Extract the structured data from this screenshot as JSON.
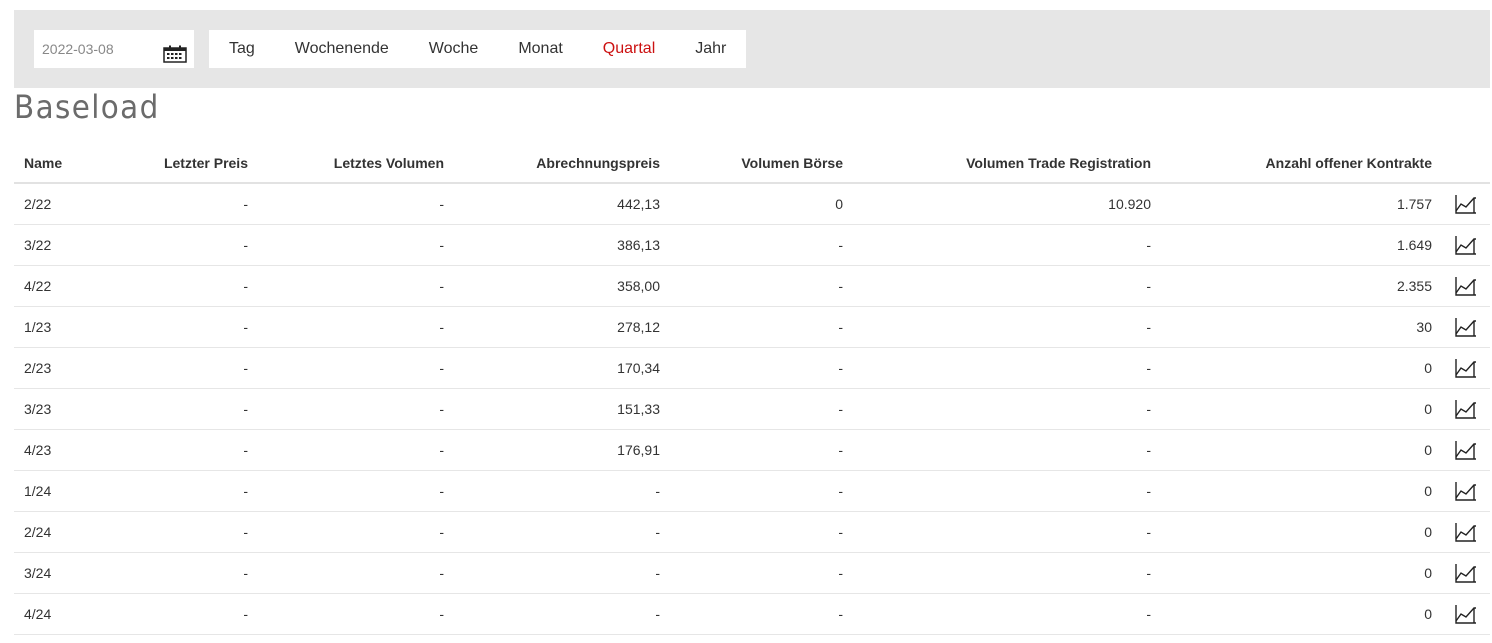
{
  "filter": {
    "date_value": "2022-03-08",
    "calendar_icon": "calendar-icon",
    "periods": [
      {
        "label": "Tag",
        "active": false
      },
      {
        "label": "Wochenende",
        "active": false
      },
      {
        "label": "Woche",
        "active": false
      },
      {
        "label": "Monat",
        "active": false
      },
      {
        "label": "Quartal",
        "active": true
      },
      {
        "label": "Jahr",
        "active": false
      }
    ],
    "active_color": "#cc1111"
  },
  "page": {
    "title": "Baseload"
  },
  "table": {
    "headers": [
      "Name",
      "Letzter Preis",
      "Letztes Volumen",
      "Abrechnungspreis",
      "Volumen Börse",
      "Volumen Trade Registration",
      "Anzahl offener Kontrakte"
    ],
    "row_icon": "line-chart-icon",
    "rows": [
      [
        "2/22",
        "-",
        "-",
        "442,13",
        "0",
        "10.920",
        "1.757"
      ],
      [
        "3/22",
        "-",
        "-",
        "386,13",
        "-",
        "-",
        "1.649"
      ],
      [
        "4/22",
        "-",
        "-",
        "358,00",
        "-",
        "-",
        "2.355"
      ],
      [
        "1/23",
        "-",
        "-",
        "278,12",
        "-",
        "-",
        "30"
      ],
      [
        "2/23",
        "-",
        "-",
        "170,34",
        "-",
        "-",
        "0"
      ],
      [
        "3/23",
        "-",
        "-",
        "151,33",
        "-",
        "-",
        "0"
      ],
      [
        "4/23",
        "-",
        "-",
        "176,91",
        "-",
        "-",
        "0"
      ],
      [
        "1/24",
        "-",
        "-",
        "-",
        "-",
        "-",
        "0"
      ],
      [
        "2/24",
        "-",
        "-",
        "-",
        "-",
        "-",
        "0"
      ],
      [
        "3/24",
        "-",
        "-",
        "-",
        "-",
        "-",
        "0"
      ],
      [
        "4/24",
        "-",
        "-",
        "-",
        "-",
        "-",
        "0"
      ]
    ]
  }
}
